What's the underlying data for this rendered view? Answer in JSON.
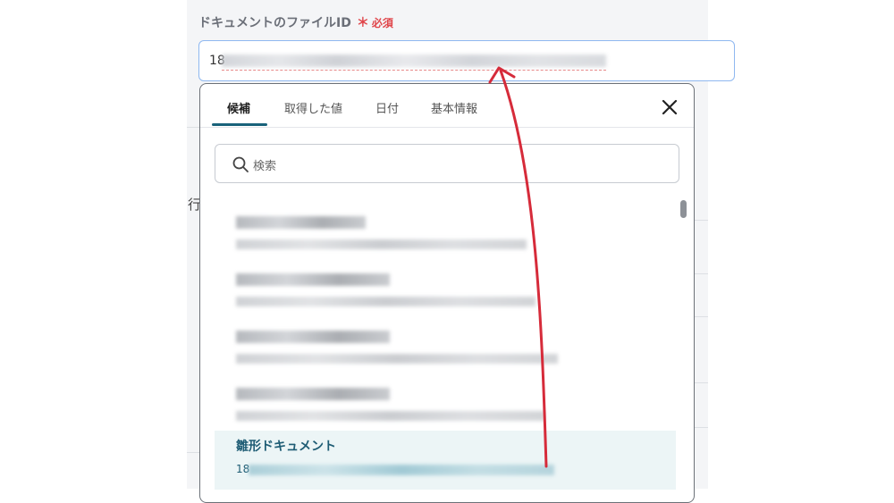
{
  "field": {
    "label": "ドキュメントのファイルID",
    "required_mark": "＊",
    "required_text": "必須",
    "value_prefix": "18"
  },
  "background": {
    "partial_label": "行"
  },
  "panel": {
    "tabs": [
      {
        "label": "候補",
        "active": true
      },
      {
        "label": "取得した値",
        "active": false
      },
      {
        "label": "日付",
        "active": false
      },
      {
        "label": "基本情報",
        "active": false
      }
    ],
    "search": {
      "placeholder": "検索"
    },
    "selected_item": {
      "title": "雛形ドキュメント",
      "id_prefix": "18"
    }
  },
  "colors": {
    "accent": "#19627a",
    "required": "#e0464b",
    "arrow": "#d62b3a",
    "selected_bg": "#ecf5f6"
  },
  "icons": {
    "close": "close-icon",
    "search": "search-icon"
  }
}
